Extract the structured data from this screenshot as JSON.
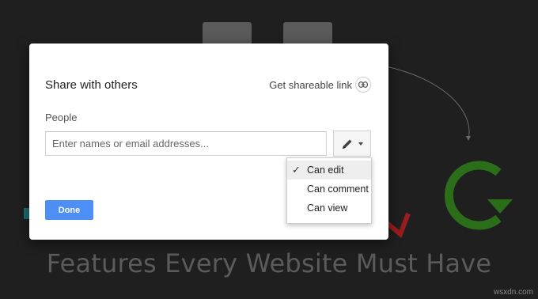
{
  "dialog": {
    "title": "Share with others",
    "shareable_link": "Get shareable link",
    "people_label": "People",
    "name_input": {
      "value": "",
      "placeholder": "Enter names or email addresses..."
    },
    "done_label": "Done"
  },
  "permission_menu": {
    "items": [
      {
        "label": "Can edit",
        "selected": true
      },
      {
        "label": "Can comment",
        "selected": false
      },
      {
        "label": "Can view",
        "selected": false
      }
    ]
  },
  "background": {
    "tagline": "Features Every Website Must Have",
    "watermark": "wsxdn.com"
  },
  "colors": {
    "accent": "#4d8ff5",
    "overlay": "#1f1f1f",
    "refresh_icon": "#2a6e1a",
    "download_icon": "#b02020"
  },
  "icons": [
    "link-icon",
    "pencil-icon",
    "check-icon",
    "refresh-icon",
    "download-icon"
  ]
}
